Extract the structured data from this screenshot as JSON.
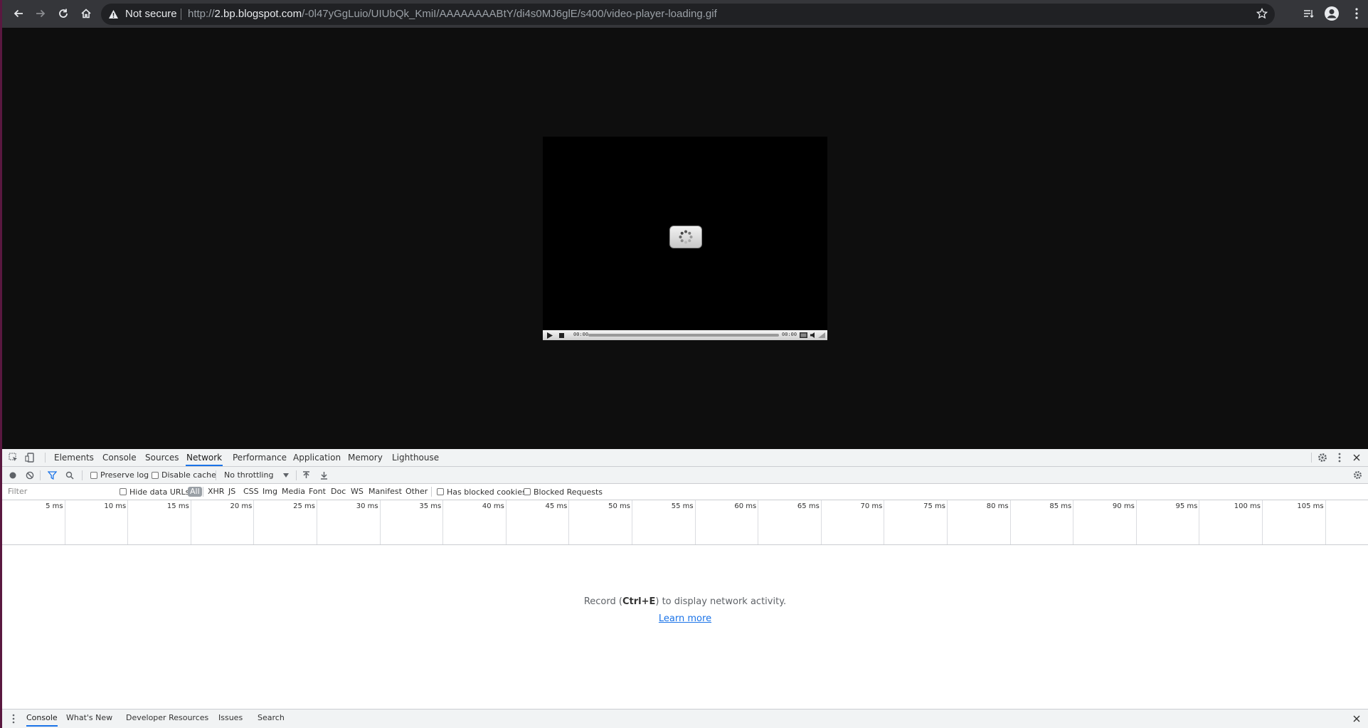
{
  "browser": {
    "security_label": "Not secure",
    "url_prefix": "http://",
    "url_host": "2.bp.blogspot.com",
    "url_path": "/-0l47yGgLuio/UIUbQk_KmiI/AAAAAAAABtY/di4s0MJ6glE/s400/video-player-loading.gif"
  },
  "player": {
    "time_elapsed": "00:00",
    "time_total": "00:00"
  },
  "devtools": {
    "tabs": [
      "Elements",
      "Console",
      "Sources",
      "Network",
      "Performance",
      "Application",
      "Memory",
      "Lighthouse"
    ],
    "active_tab": "Network",
    "toolbar": {
      "preserve_log": "Preserve log",
      "disable_cache": "Disable cache",
      "throttling": "No throttling"
    },
    "filter": {
      "placeholder": "Filter",
      "hide_data_urls": "Hide data URLs",
      "types": [
        "All",
        "XHR",
        "JS",
        "CSS",
        "Img",
        "Media",
        "Font",
        "Doc",
        "WS",
        "Manifest",
        "Other"
      ],
      "has_blocked_cookies": "Has blocked cookies",
      "blocked_requests": "Blocked Requests"
    },
    "timeline_ticks": [
      "5 ms",
      "10 ms",
      "15 ms",
      "20 ms",
      "25 ms",
      "30 ms",
      "35 ms",
      "40 ms",
      "45 ms",
      "50 ms",
      "55 ms",
      "60 ms",
      "65 ms",
      "70 ms",
      "75 ms",
      "80 ms",
      "85 ms",
      "90 ms",
      "95 ms",
      "100 ms",
      "105 ms"
    ],
    "empty": {
      "prefix": "Record (",
      "shortcut": "Ctrl+E",
      "suffix": ") to display network activity.",
      "link": "Learn more"
    },
    "drawer_tabs": [
      "Console",
      "What's New",
      "Developer Resources",
      "Issues",
      "Search"
    ]
  },
  "colors": {
    "accent": "#1a73e8",
    "toolbar_bg": "#35363a",
    "page_bg": "#0e0e0e"
  }
}
